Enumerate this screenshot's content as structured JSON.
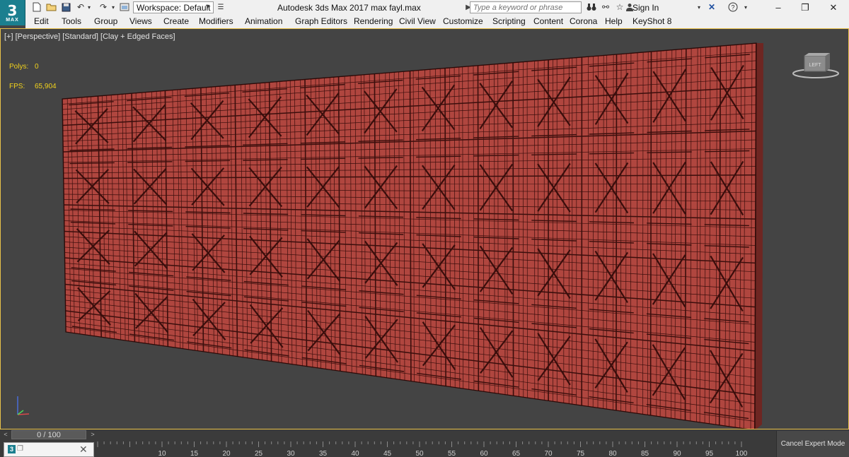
{
  "app": {
    "logo_number": "3",
    "logo_text": "MAX",
    "window_title": "Autodesk 3ds Max 2017      max fayl.max"
  },
  "toolbar": {
    "workspace_value": "Workspace: Default",
    "search_placeholder": "Type a keyword or phrase",
    "signin_label": "Sign In",
    "icons": [
      "new-file-icon",
      "open-folder-icon",
      "save-icon",
      "undo-icon",
      "redo-icon",
      "project-folder-icon",
      "binoculars-icon",
      "star-icon",
      "user-icon",
      "close-x-icon",
      "help-icon"
    ]
  },
  "menu": {
    "items": [
      "Edit",
      "Tools",
      "Group",
      "Views",
      "Create",
      "Modifiers",
      "Animation",
      "Graph Editors",
      "Rendering",
      "Civil View",
      "Customize",
      "Scripting",
      "Content",
      "Corona",
      "Help",
      "KeyShot 8"
    ]
  },
  "viewport": {
    "label": "[+] [Perspective] [Standard] [Clay + Edged Faces]",
    "polys_label": "Polys:",
    "polys_value": "0",
    "fps_label": "FPS:",
    "fps_value": "65,904",
    "viewcube_label": "LEFT",
    "mesh_color": "#b0463f",
    "border_color": "#e8c14a"
  },
  "timeslider": {
    "frame_label": "0 / 100",
    "prev_arrow": "<",
    "next_arrow": ">"
  },
  "trackbar": {
    "tick_labels": [
      "10",
      "15",
      "20",
      "25",
      "30",
      "35",
      "40",
      "45",
      "50",
      "55",
      "60",
      "65",
      "70",
      "75",
      "80",
      "85",
      "90",
      "95",
      "100"
    ]
  },
  "status": {
    "expert_button": "Cancel Expert Mode",
    "listener_close": "✕"
  }
}
